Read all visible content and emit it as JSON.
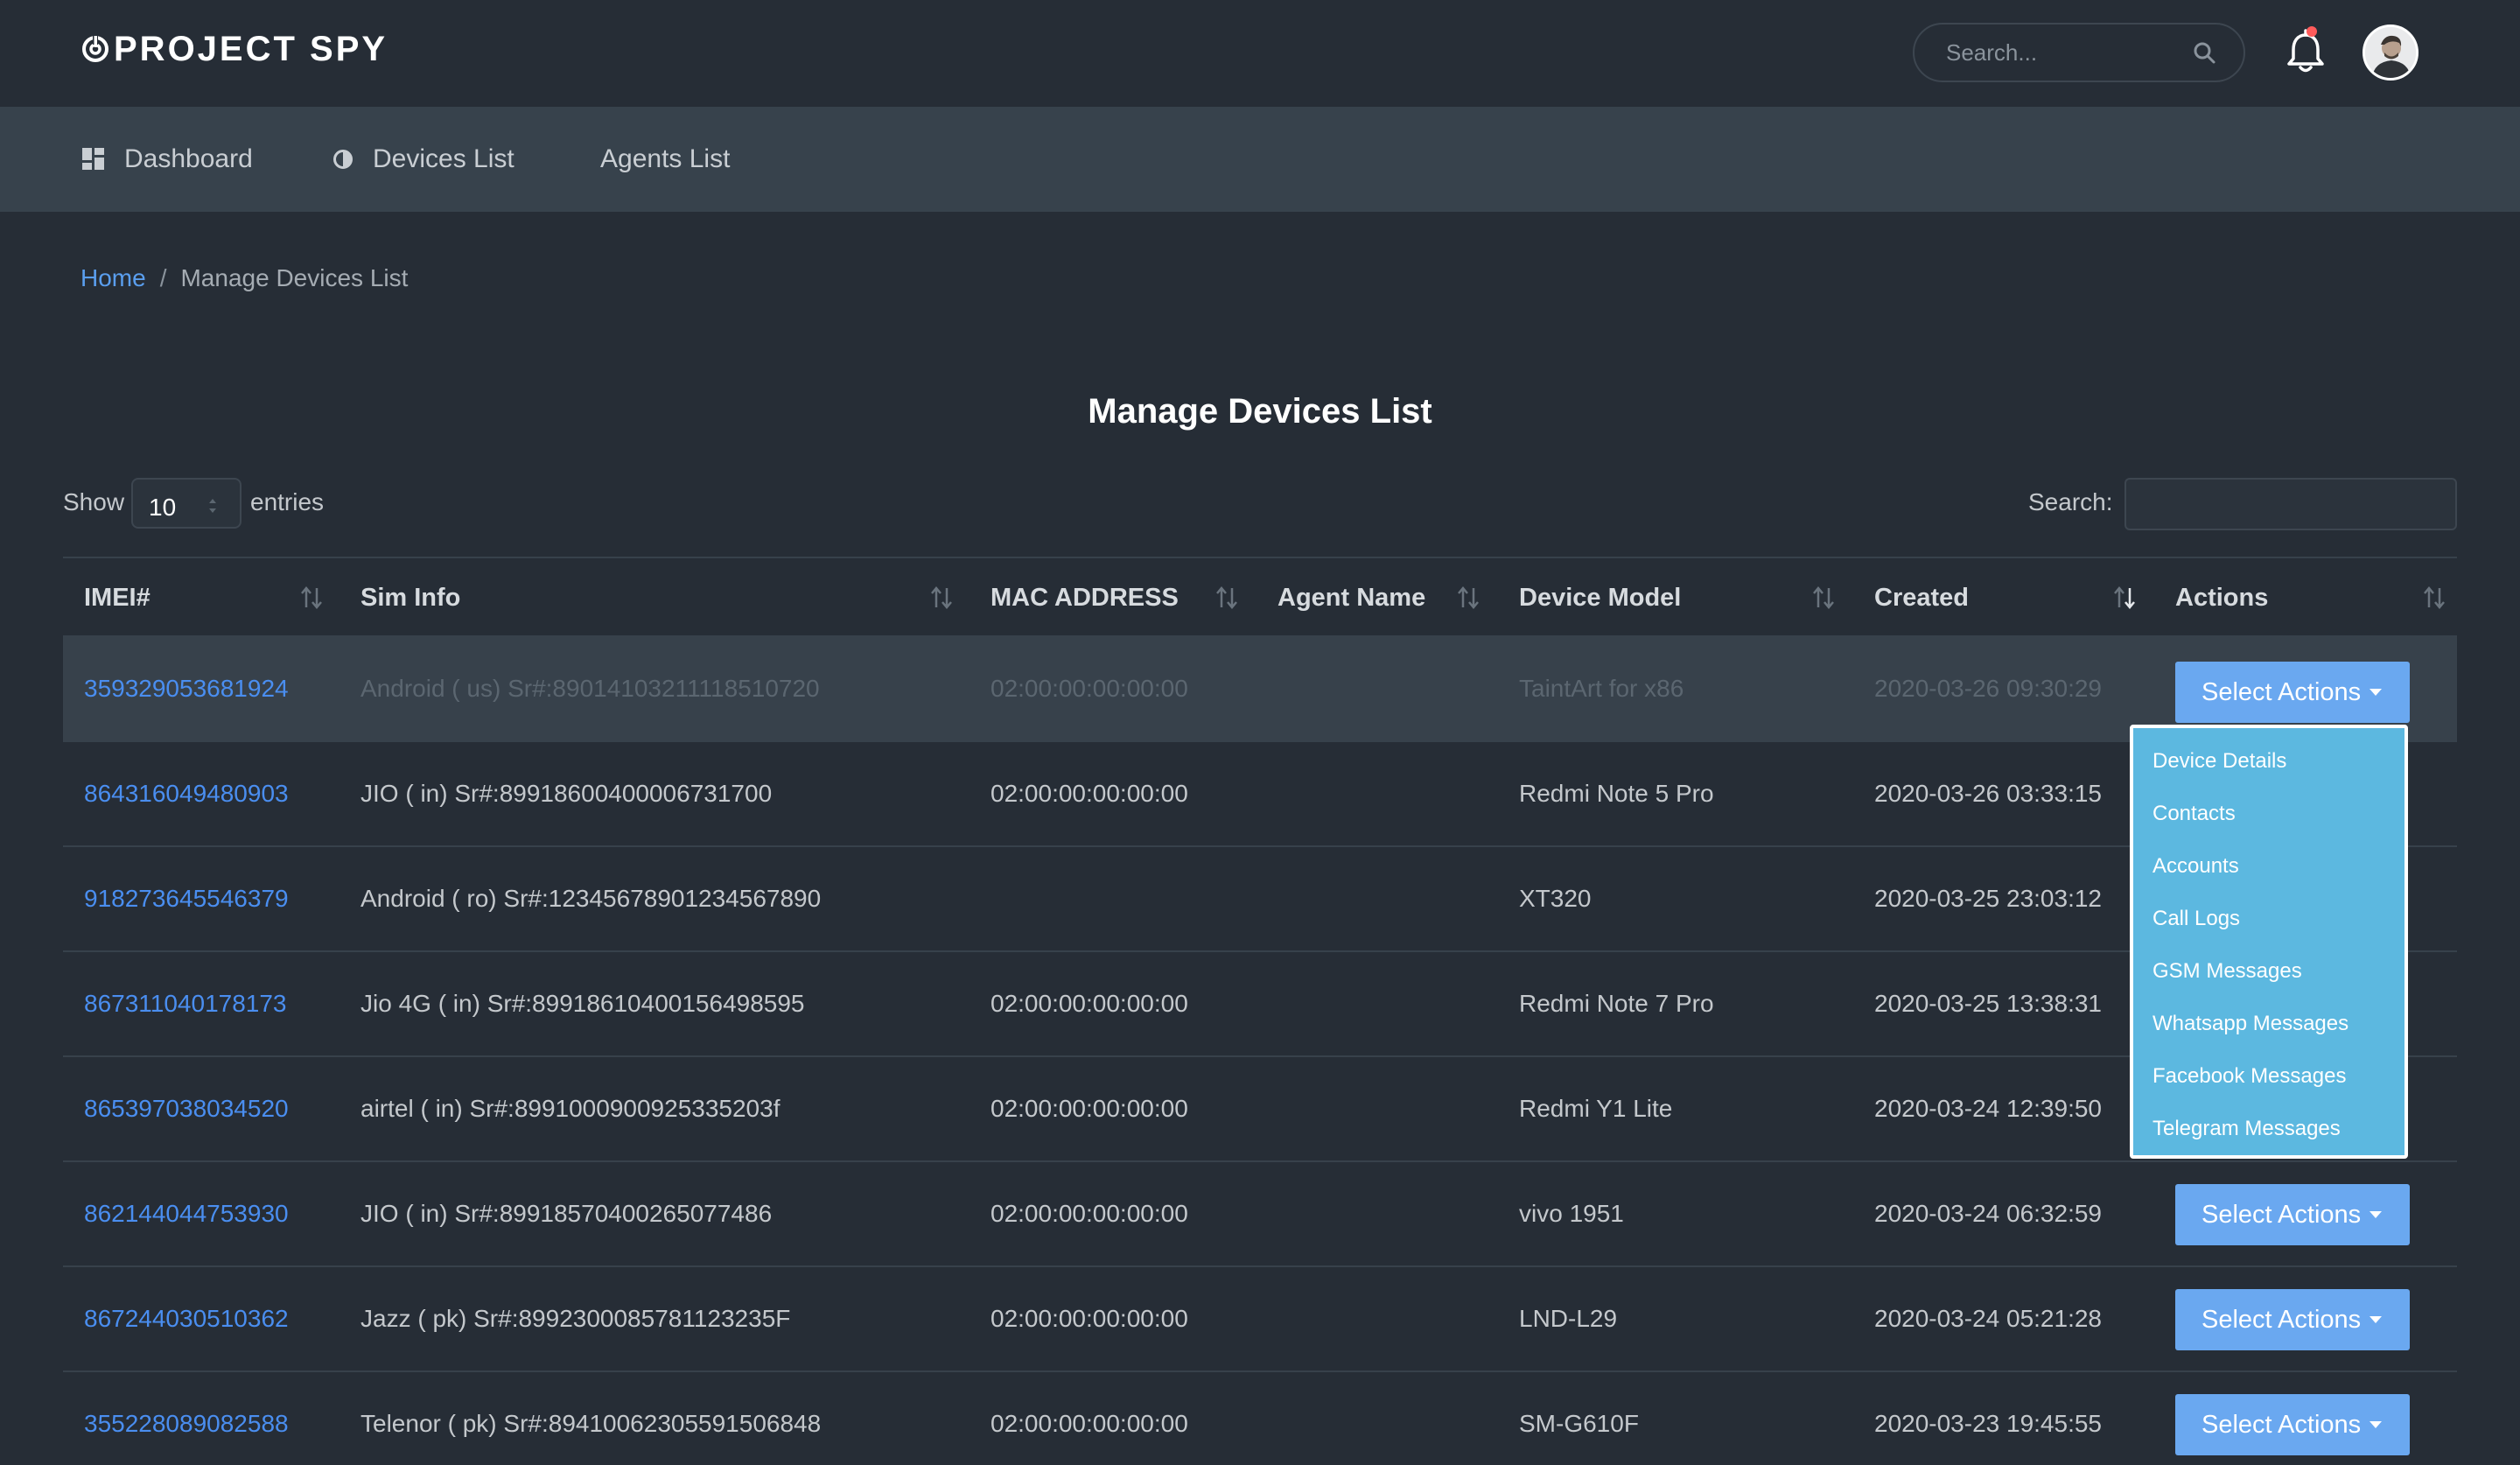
{
  "app": {
    "brand": "PROJECT SPY"
  },
  "header": {
    "search_placeholder": "Search..."
  },
  "nav": {
    "items": [
      {
        "label": "Dashboard",
        "icon": "dashboard-icon"
      },
      {
        "label": "Devices List",
        "icon": "devices-icon"
      },
      {
        "label": "Agents List",
        "icon": ""
      }
    ]
  },
  "breadcrumb": {
    "home": "Home",
    "separator": "/",
    "current": "Manage Devices List"
  },
  "page": {
    "title": "Manage Devices List"
  },
  "controls": {
    "show_label": "Show",
    "entries_value": "10",
    "entries_label": "entries",
    "search_label": "Search:"
  },
  "table": {
    "columns": [
      "IMEI#",
      "Sim Info",
      "MAC ADDRESS",
      "Agent Name",
      "Device Model",
      "Created",
      "Actions"
    ],
    "action_label": "Select Actions",
    "rows": [
      {
        "imei": "359329053681924",
        "sim": "Android ( us) Sr#:8901410321111851072​0",
        "mac": "02:00:00:00:00:00",
        "agent": "",
        "model": "TaintArt for x86",
        "created": "2020-03-26 09:30:29"
      },
      {
        "imei": "864316049480903",
        "sim": "JIO ( in) Sr#:89918600400006731700",
        "mac": "02:00:00:00:00:00",
        "agent": "",
        "model": "Redmi Note 5 Pro",
        "created": "2020-03-26 03:33:15"
      },
      {
        "imei": "918273645546379",
        "sim": "Android ( ro) Sr#:12345678901234567890",
        "mac": "",
        "agent": "",
        "model": "XT320",
        "created": "2020-03-25 23:03:12"
      },
      {
        "imei": "867311040178173",
        "sim": "Jio 4G ( in) Sr#:89918610400156498595",
        "mac": "02:00:00:00:00:00",
        "agent": "",
        "model": "Redmi Note 7 Pro",
        "created": "2020-03-25 13:38:31"
      },
      {
        "imei": "865397038034520",
        "sim": "airtel ( in) Sr#:8991000900925335203f",
        "mac": "02:00:00:00:00:00",
        "agent": "",
        "model": "Redmi Y1 Lite",
        "created": "2020-03-24 12:39:50"
      },
      {
        "imei": "862144044753930",
        "sim": "JIO ( in) Sr#:89918570400265077486",
        "mac": "02:00:00:00:00:00",
        "agent": "",
        "model": "vivo 1951",
        "created": "2020-03-24 06:32:59"
      },
      {
        "imei": "867244030510362",
        "sim": "Jazz ( pk) Sr#:8992300085781123235F",
        "mac": "02:00:00:00:00:00",
        "agent": "",
        "model": "LND-L29",
        "created": "2020-03-24 05:21:28"
      },
      {
        "imei": "355228089082588",
        "sim": "Telenor ( pk) Sr#:89410062305591506848",
        "mac": "02:00:00:00:00:00",
        "agent": "",
        "model": "SM-G610F",
        "created": "2020-03-23 19:45:55"
      }
    ]
  },
  "dropdown": {
    "items": [
      "Device Details",
      "Contacts",
      "Accounts",
      "Call Logs",
      "GSM Messages",
      "Whatsapp Messages",
      "Facebook Messages",
      "Telegram Messages"
    ]
  },
  "colors": {
    "background": "#262d36",
    "navbar": "#37424c",
    "link": "#4a8ef0",
    "button": "#6aa8f0",
    "dropdown": "#5cb8e0",
    "notification_dot": "#ff5b5b"
  }
}
